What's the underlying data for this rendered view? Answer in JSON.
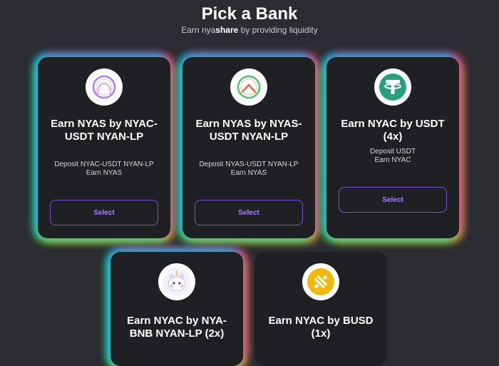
{
  "header": {
    "title": "Pick a Bank",
    "subtitle_prefix": "Earn nya",
    "subtitle_bold": "share",
    "subtitle_suffix": " by providing liquidity"
  },
  "cards": [
    {
      "title": "Earn NYAS by NYAC-USDT NYAN-LP",
      "desc_line1": "Deposit NYAC-USDT NYAN-LP",
      "desc_line2": "Earn NYAS",
      "button": "Select",
      "icon": "nyac-usdt-lp-icon"
    },
    {
      "title": "Earn NYAS by NYAS-USDT NYAN-LP",
      "desc_line1": "Deposit NYAS-USDT NYAN-LP",
      "desc_line2": "Earn NYAS",
      "button": "Select",
      "icon": "nyas-usdt-lp-icon"
    },
    {
      "title": "Earn NYAC by USDT (4x)",
      "desc_line1": "Deposit USDT",
      "desc_line2": "Earn NYAC",
      "button": "Select",
      "icon": "tether-icon"
    },
    {
      "title": "Earn NYAC by NYA-BNB NYAN-LP (2x)",
      "icon": "unicorn-cat-icon"
    },
    {
      "title": "Earn NYAC by BUSD (1x)",
      "icon": "busd-icon"
    }
  ],
  "colors": {
    "background": "#2b2c31",
    "card": "#1f2024",
    "accent": "#a680ff",
    "tether": "#26a17b",
    "busd": "#f0b90b"
  }
}
